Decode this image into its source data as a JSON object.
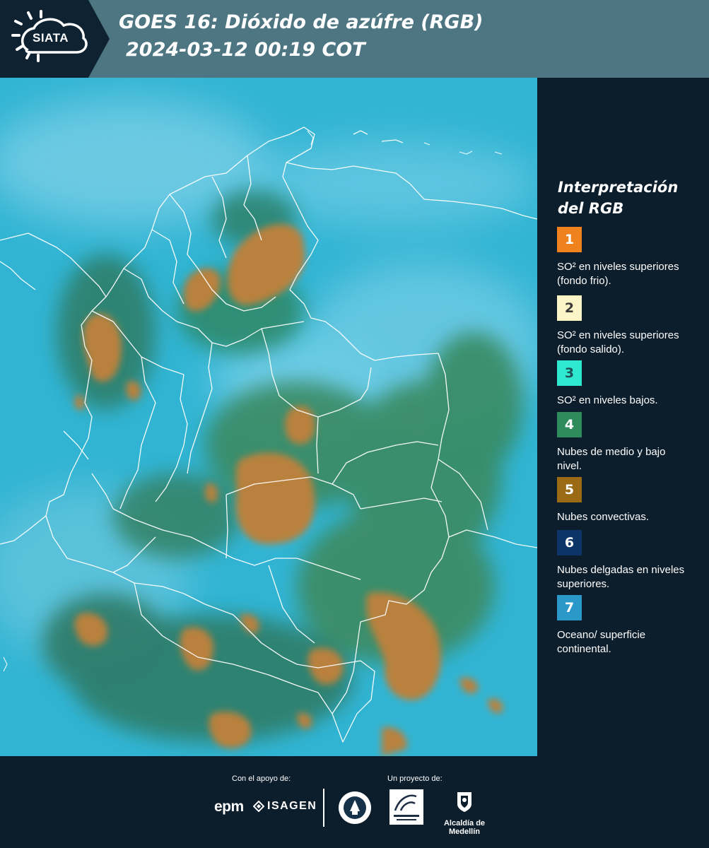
{
  "header": {
    "brand": "SIATA",
    "title_line1": "GOES 16: Dióxido de azúfre (RGB)",
    "title_line2": "2024-03-12 00:19 COT"
  },
  "legend": {
    "title": "Interpretación del RGB",
    "items": [
      {
        "number": "1",
        "label": "SO² en niveles superiores (fondo frio).",
        "color": "#f0821e",
        "text_color": "#ffffff"
      },
      {
        "number": "2",
        "label": "SO² en niveles superiores (fondo salido).",
        "color": "#fcf5c8",
        "text_color": "#3a3a3a"
      },
      {
        "number": "3",
        "label": "SO² en niveles bajos.",
        "color": "#2ee8cf",
        "text_color": "#1f4f57"
      },
      {
        "number": "4",
        "label": "Nubes de medio y bajo nivel.",
        "color": "#2e8c5c",
        "text_color": "#ffffff"
      },
      {
        "number": "5",
        "label": "Nubes convectivas.",
        "color": "#9a6a14",
        "text_color": "#ffffff"
      },
      {
        "number": "6",
        "label": "Nubes delgadas en niveles superiores.",
        "color": "#0d3466",
        "text_color": "#ffffff"
      },
      {
        "number": "7",
        "label": "Oceano/ superficie continental.",
        "color": "#2a98c8",
        "text_color": "#ffffff"
      }
    ]
  },
  "footer": {
    "support_label": "Con el apoyo de:",
    "project_label": "Un proyecto de:",
    "sponsor_1": "epm",
    "sponsor_2": "ISAGEN",
    "partner_2": "Área Metropolitana Valle de Aburrá",
    "partner_3": "Alcaldía de Medellín"
  },
  "colors": {
    "header_bg": "#4d7682",
    "panel_bg": "#0c1d2b",
    "ocean": "#32b6d4",
    "convective": "#b5803c",
    "low_cloud": "#3a8a72"
  }
}
